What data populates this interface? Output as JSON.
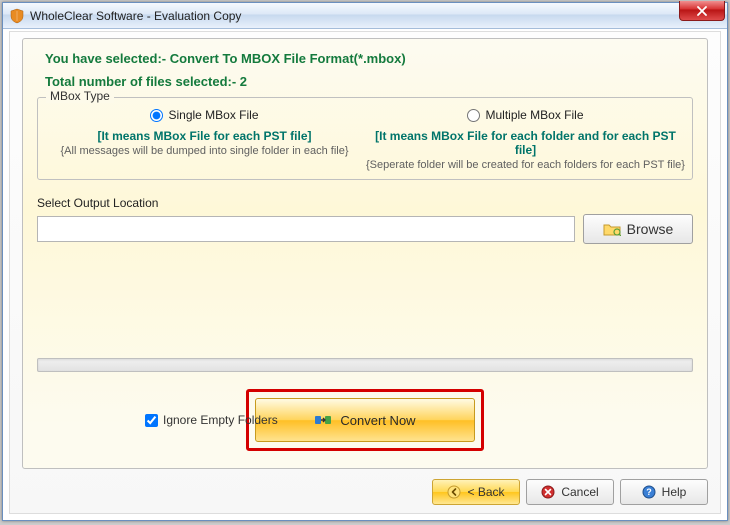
{
  "window": {
    "title": "WholeClear Software - Evaluation Copy"
  },
  "info": {
    "selected_line": "You have selected:- Convert To MBOX File Format(*.mbox)",
    "total_line": "Total number of files selected:- 2"
  },
  "mbox": {
    "legend": "MBox Type",
    "single": {
      "label": "Single MBox File",
      "hint1": "[It means MBox File for each PST file]",
      "hint2": "{All messages will be dumped into single folder in each file}",
      "checked": true
    },
    "multiple": {
      "label": "Multiple MBox File",
      "hint1": "[It means MBox File for each folder and for each PST file]",
      "hint2": "{Seperate folder will be created for each folders for each PST file}",
      "checked": false
    }
  },
  "output": {
    "label": "Select Output Location",
    "value": "",
    "browse_label": "Browse"
  },
  "options": {
    "ignore_empty_label": "Ignore Empty Folders",
    "ignore_empty_checked": true,
    "convert_label": "Convert Now"
  },
  "nav": {
    "back_label": "< Back",
    "cancel_label": "Cancel",
    "help_label": "Help"
  }
}
